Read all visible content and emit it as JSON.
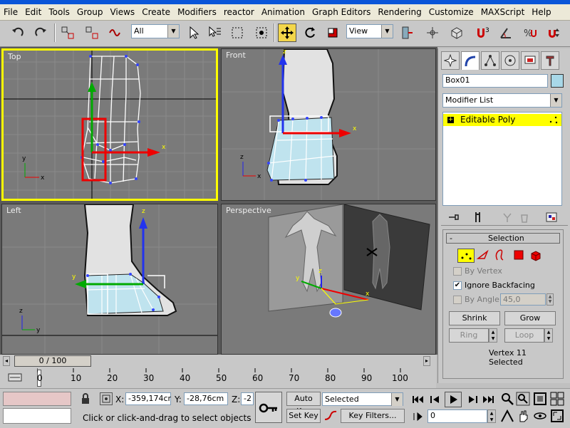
{
  "menu": [
    "File",
    "Edit",
    "Tools",
    "Group",
    "Views",
    "Create",
    "Modifiers",
    "reactor",
    "Animation",
    "Graph Editors",
    "Rendering",
    "Customize",
    "MAXScript",
    "Help"
  ],
  "toolbar": {
    "selection_filter": "All",
    "ref_coord": "View",
    "icons": [
      "undo-icon",
      "redo-icon",
      "select-and-link-icon",
      "unlink-icon",
      "bind-space-warp-icon",
      "select-object-icon",
      "select-by-name-icon",
      "rect-selection-region-icon",
      "window-crossing-icon",
      "select-and-move-icon",
      "select-and-rotate-icon",
      "select-and-scale-icon",
      "use-pivot-center-icon",
      "select-manipulate-icon",
      "keyboard-shortcut-icon",
      "snaps-toggle-icon",
      "angle-snap-icon",
      "percent-snap-icon",
      "spinner-snap-icon"
    ]
  },
  "viewports": {
    "top": {
      "label": "Top"
    },
    "front": {
      "label": "Front"
    },
    "left": {
      "label": "Left"
    },
    "perspective": {
      "label": "Perspective"
    },
    "axis": {
      "x": "x",
      "y": "y",
      "z": "z"
    }
  },
  "command_panel": {
    "tabs": [
      "create-tab",
      "modify-tab",
      "hierarchy-tab",
      "motion-tab",
      "display-tab",
      "utilities-tab"
    ],
    "object_name": "Box01",
    "object_color": "#a8d8e8",
    "modifier_list": "Modifier List",
    "stack_item": "Editable Poly",
    "selection_rollout": {
      "title": "Selection",
      "by_vertex": "By Vertex",
      "ignore_backfacing": "Ignore Backfacing",
      "by_angle": "By Angle:",
      "angle_value": "45,0",
      "shrink": "Shrink",
      "grow": "Grow",
      "ring": "Ring",
      "loop": "Loop",
      "status": "Vertex 11 Selected"
    },
    "selection_rollout_collapse": "-"
  },
  "timeline": {
    "slider_label": "0 / 100",
    "ticks": [
      "0",
      "10",
      "20",
      "30",
      "40",
      "50",
      "60",
      "70",
      "80",
      "90",
      "100"
    ]
  },
  "status_bar": {
    "x_label": "X:",
    "x_value": "-359,174cr",
    "y_label": "Y:",
    "y_value": "-28,76cm",
    "z_label": "Z:",
    "z_value": "-2",
    "prompt": "Click or click-and-drag to select objects",
    "auto_key": "Auto Key",
    "set_key": "Set Key",
    "selected": "Selected",
    "key_filters": "Key Filters...",
    "frame": "0"
  },
  "colors": {
    "active_viewport_border": "#ffff00",
    "selection_highlight": "#ffff00",
    "active_tool": "#f3d64a",
    "viewport_bg": "#7a7a7a"
  }
}
